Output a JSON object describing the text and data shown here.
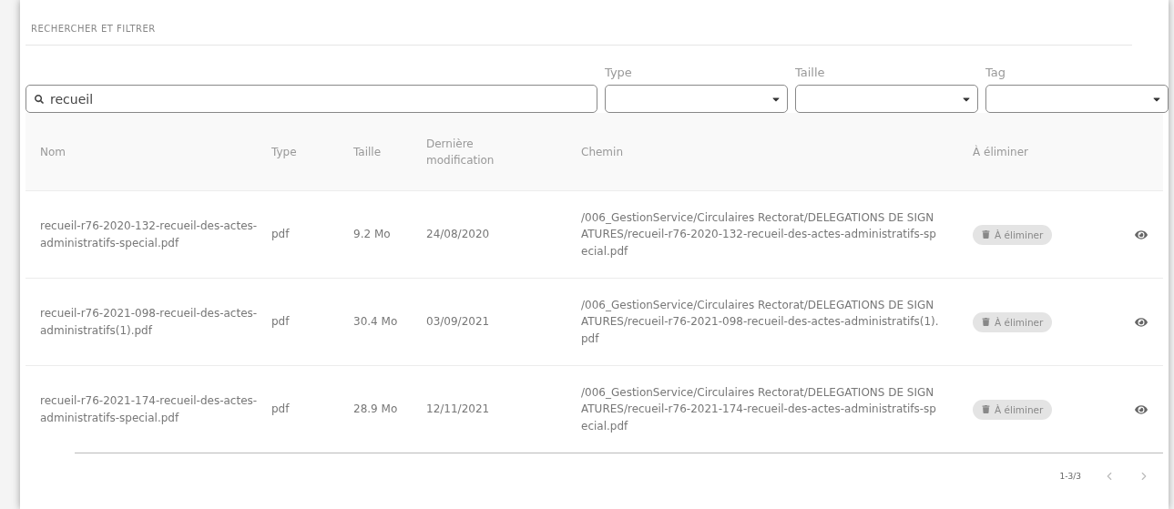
{
  "section_title": "RECHERCHER ET FILTRER",
  "search": {
    "value": "recueil"
  },
  "filters": [
    {
      "label": "Type"
    },
    {
      "label": "Taille"
    },
    {
      "label": "Tag"
    }
  ],
  "table": {
    "columns": [
      "Nom",
      "Type",
      "Taille",
      "Dernière modification",
      "Chemin",
      "À éliminer"
    ],
    "rows": [
      {
        "name": "recueil-r76-2020-132-recueil-des-actes-administratifs-special.pdf",
        "type": "pdf",
        "size": "9.2 Mo",
        "modified": "24/08/2020",
        "path": "/006_GestionService/Circulaires Rectorat/DELEGATIONS DE SIGNATURES/recueil-r76-2020-132-recueil-des-actes-administratifs-special.pdf",
        "action": "À éliminer"
      },
      {
        "name": "recueil-r76-2021-098-recueil-des-actes-administratifs(1).pdf",
        "type": "pdf",
        "size": "30.4 Mo",
        "modified": "03/09/2021",
        "path": "/006_GestionService/Circulaires Rectorat/DELEGATIONS DE SIGNATURES/recueil-r76-2021-098-recueil-des-actes-administratifs(1).pdf",
        "action": "À éliminer"
      },
      {
        "name": "recueil-r76-2021-174-recueil-des-actes-administratifs-special.pdf",
        "type": "pdf",
        "size": "28.9 Mo",
        "modified": "12/11/2021",
        "path": "/006_GestionService/Circulaires Rectorat/DELEGATIONS DE SIGNATURES/recueil-r76-2021-174-recueil-des-actes-administratifs-special.pdf",
        "action": "À éliminer"
      }
    ]
  },
  "pagination": {
    "range": "1-3/3",
    "prev_disabled": true,
    "next_disabled": true
  }
}
